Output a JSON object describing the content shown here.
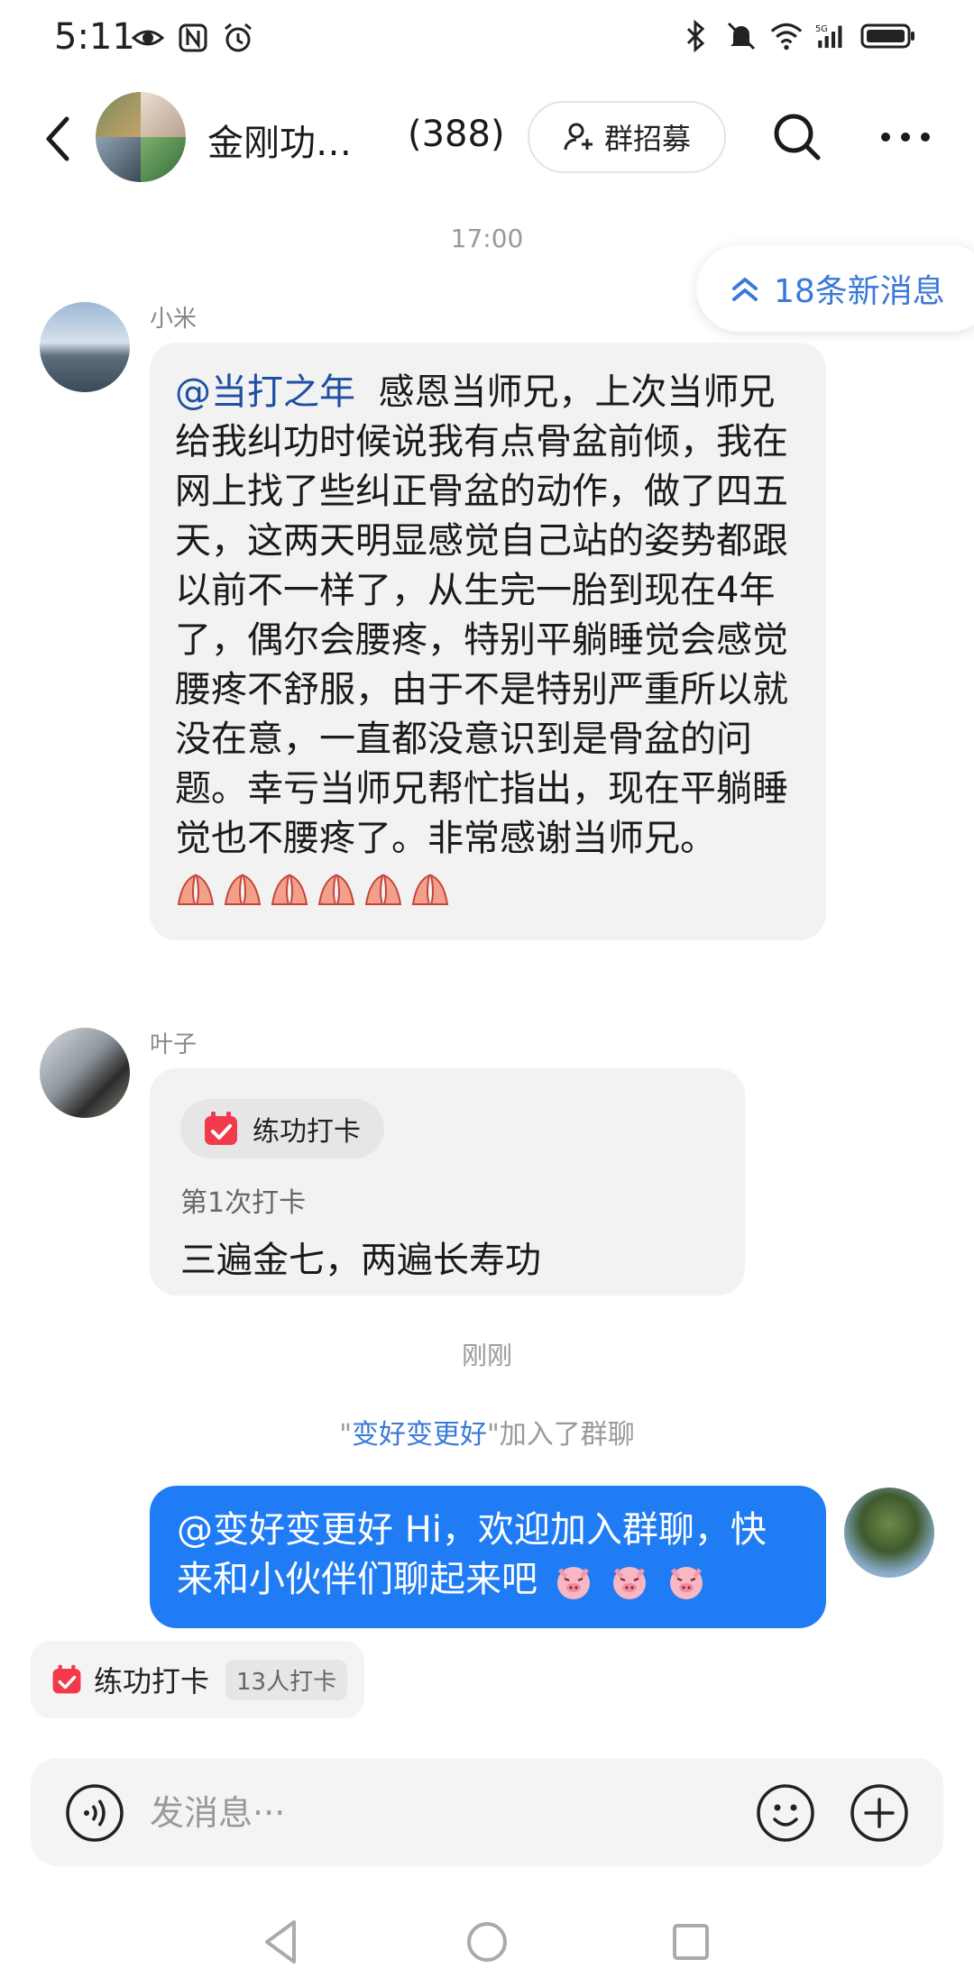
{
  "status_bar": {
    "time": "5:11"
  },
  "header": {
    "group_name": "金刚功…",
    "member_count": "(388)",
    "recruit_label": "群招募"
  },
  "chat": {
    "timestamp_1": "17:00",
    "new_messages": "18条新消息",
    "msg1": {
      "sender": "小米",
      "mention": "@当打之年",
      "text": "感恩当师兄，上次当师兄给我纠功时候说我有点骨盆前倾，我在网上找了些纠正骨盆的动作，做了四五天，这两天明显感觉自己站的姿势都跟以前不一样了，从生完一胎到现在4年了，偶尔会腰疼，特别平躺睡觉会感觉腰疼不舒服，由于不是特别严重所以就没在意，一直都没意识到是骨盆的问题。幸亏当师兄帮忙指出，现在平躺睡觉也不腰疼了。非常感谢当师兄。"
    },
    "msg2": {
      "sender": "叶子",
      "tag": "练功打卡",
      "sub": "第1次打卡",
      "text": "三遍金七，两遍长寿功"
    },
    "timestamp_2": "刚刚",
    "join_notice": {
      "quote_open": "\"",
      "name": "变好变更好",
      "suffix": "\"加入了群聊"
    },
    "my_msg": {
      "mention": "@变好变更好",
      "text": " Hi，欢迎加入群聊，快来和小伙伴们聊起来吧"
    }
  },
  "bottom_checkin": {
    "label": "练功打卡",
    "count": "13人打卡"
  },
  "input": {
    "placeholder": "发消息···"
  },
  "colors": {
    "accent": "#1f7cf5",
    "link": "#3a78d9",
    "mention": "#1d4fa3",
    "checkin_red": "#f23a4a"
  }
}
